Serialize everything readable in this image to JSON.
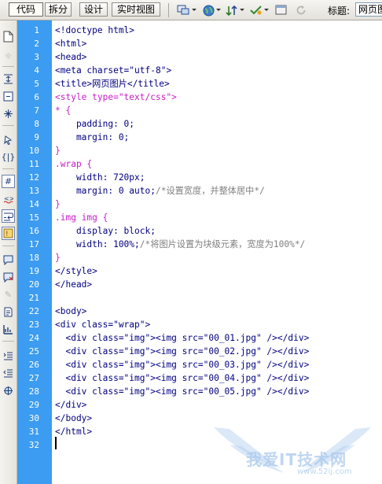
{
  "toolbar": {
    "code_label": "代码",
    "split_label": "拆分",
    "design_label": "设计",
    "live_label": "实时视图",
    "title_label": "标题:",
    "title_value": "网页图"
  },
  "colors": {
    "gutter": "#3b9cf1",
    "tag": "#000080",
    "selector": "#c81ec8",
    "comment": "#808080"
  },
  "code": {
    "line_numbers": [
      "1",
      "2",
      "3",
      "4",
      "5",
      "6",
      "7",
      "8",
      "9",
      "10",
      "11",
      "12",
      "13",
      "14",
      "15",
      "16",
      "17",
      "18",
      "19",
      "20",
      "21",
      "22",
      "23",
      "24",
      "25",
      "26",
      "27",
      "28",
      "29",
      "30",
      "31",
      "32"
    ],
    "lines": [
      "<!doctype html>",
      "<html>",
      "<head>",
      "<meta charset=\"utf-8\">",
      "<title>网页图片</title>",
      "<style type=\"text/css\">",
      "* {",
      "    padding: 0;",
      "    margin: 0;",
      "}",
      ".wrap {",
      "    width: 720px;",
      "    margin: 0 auto;/*设置宽度，并整体居中*/",
      "}",
      ".img img {",
      "    display: block;",
      "    width: 100%;/*将图片设置为块级元素，宽度为100%*/",
      "}",
      "</style>",
      "</head>",
      "",
      "<body>",
      "<div class=\"wrap\">",
      "  <div class=\"img\"><img src=\"00_01.jpg\" /></div>",
      "  <div class=\"img\"><img src=\"00_02.jpg\" /></div>",
      "  <div class=\"img\"><img src=\"00_03.jpg\" /></div>",
      "  <div class=\"img\"><img src=\"00_04.jpg\" /></div>",
      "  <div class=\"img\"><img src=\"00_05.jpg\" /></div>",
      "</div>",
      "</body>",
      "</html>",
      ""
    ]
  },
  "watermark": {
    "text": "我爱IT技术网",
    "url": "www.52ij.com"
  }
}
